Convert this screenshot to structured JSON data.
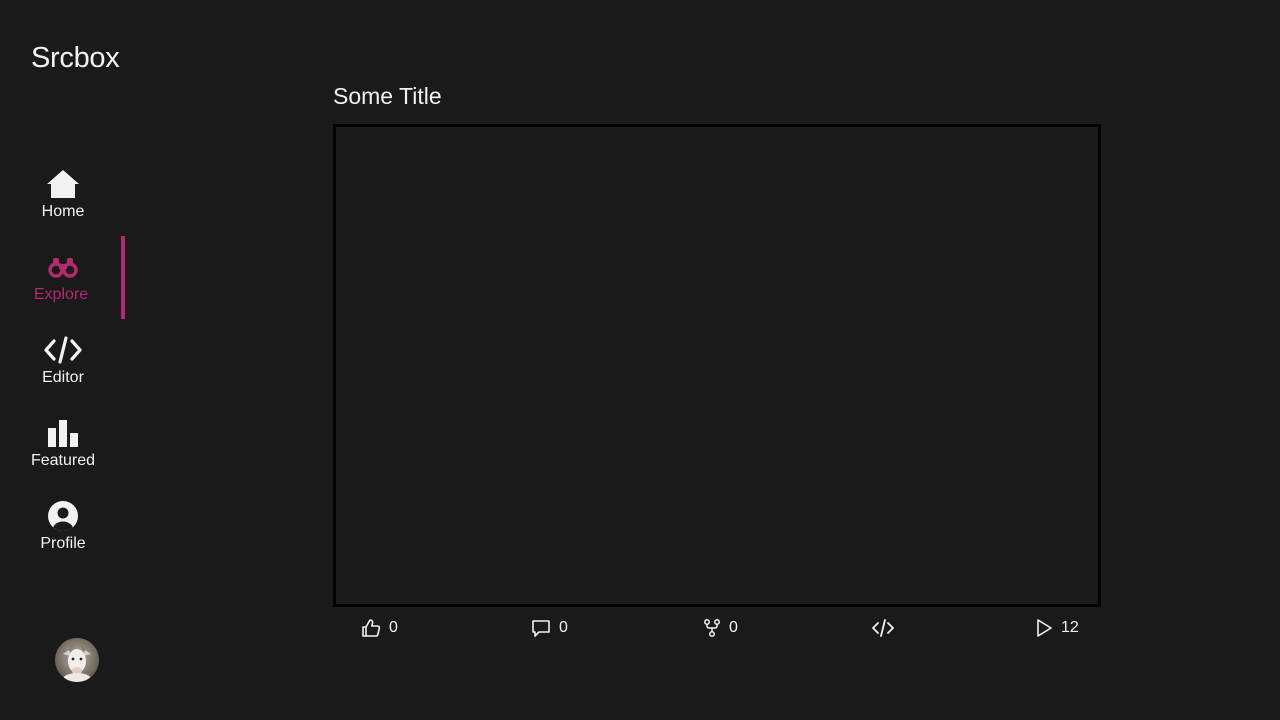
{
  "app": {
    "name": "Srcbox"
  },
  "nav": {
    "items": [
      {
        "label": "Home",
        "icon": "home-icon"
      },
      {
        "label": "Explore",
        "icon": "binoculars-icon",
        "active": true
      },
      {
        "label": "Editor",
        "icon": "code-icon"
      },
      {
        "label": "Featured",
        "icon": "bar-chart-icon"
      },
      {
        "label": "Profile",
        "icon": "user-circle-icon"
      }
    ]
  },
  "post": {
    "title": "Some Title"
  },
  "actions": {
    "likes": "0",
    "comments": "0",
    "forks": "0",
    "views": "12"
  },
  "colors": {
    "background": "#1a1a1a",
    "accent": "#b5296f",
    "text": "#f2f2f2",
    "canvas_border": "#000000"
  }
}
